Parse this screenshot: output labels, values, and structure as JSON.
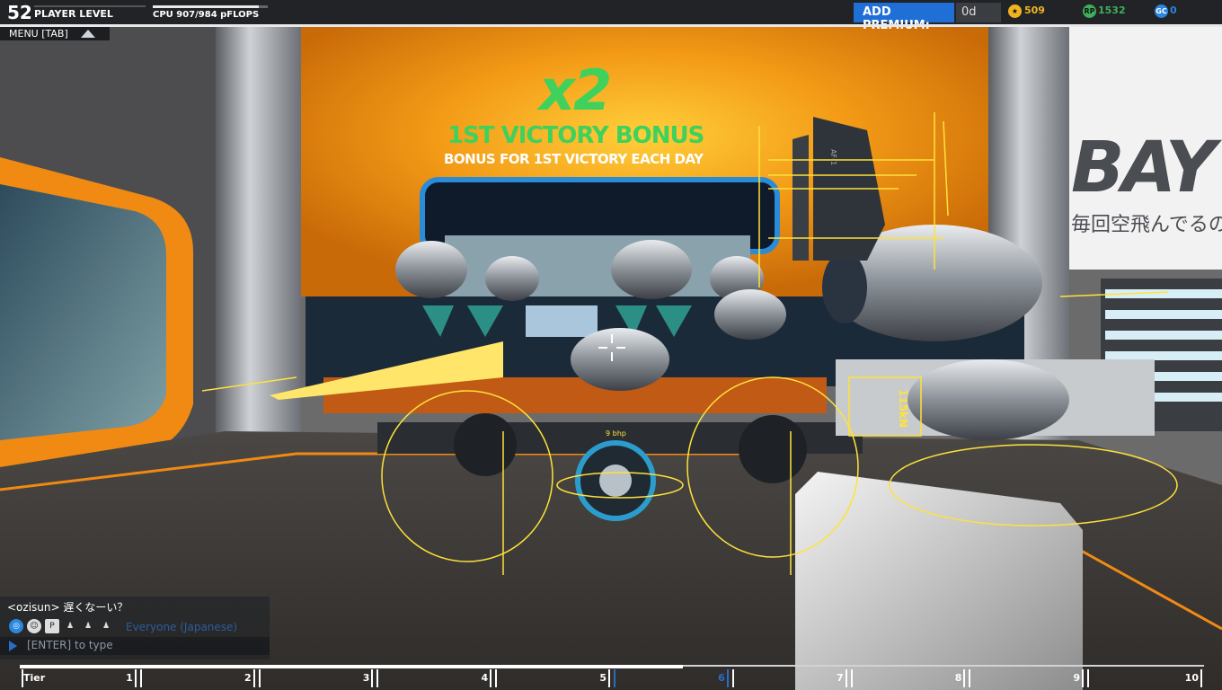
{
  "hud": {
    "player_level": "52",
    "player_level_label": "PLAYER LEVEL",
    "cpu_label": "CPU 907/984 pFLOPS",
    "cpu_used_fraction": 0.92,
    "menu_label": "MENU [TAB]"
  },
  "premium": {
    "button_label": "ADD PREMIUM:",
    "days": "0d"
  },
  "currencies": [
    {
      "icon": "star-rank-icon",
      "value": "509",
      "color": "#f0b420"
    },
    {
      "icon": "robit-points-icon",
      "value": "1532",
      "color": "#3fae5a"
    },
    {
      "icon": "galaxy-cosmetic-credits-icon",
      "value": "0",
      "color": "#2b86e0"
    }
  ],
  "bonus": {
    "multiplier": "x2",
    "title": "1ST VICTORY BONUS",
    "subtitle": "BONUS FOR 1ST VICTORY EACH DAY"
  },
  "wall_sign": {
    "big": "BAY",
    "japanese": "毎回空飛んでるの"
  },
  "thruster_readout": "115kN",
  "wheel_readout": "9 bhp",
  "wing_label": "AF-1",
  "chat": {
    "message": "<ozisun> 遅くなーい？",
    "channel": "Everyone (Japanese)",
    "input_placeholder": "[ENTER] to type",
    "channel_icons": [
      "globe-icon",
      "person-icon",
      "party-icon",
      "clan-icon",
      "friends-icon",
      "private-icon"
    ]
  },
  "tier_bar": {
    "label": "Tier",
    "tiers": [
      "1",
      "2",
      "3",
      "4",
      "5",
      "6",
      "7",
      "8",
      "9",
      "10"
    ],
    "current_tier": "6",
    "progress_fraction": 0.56
  },
  "colors": {
    "accent_blue": "#1f6fd6",
    "bonus_green": "#3fd15c",
    "outline_yellow": "#ffe23a",
    "garage_orange": "#f18a12"
  }
}
